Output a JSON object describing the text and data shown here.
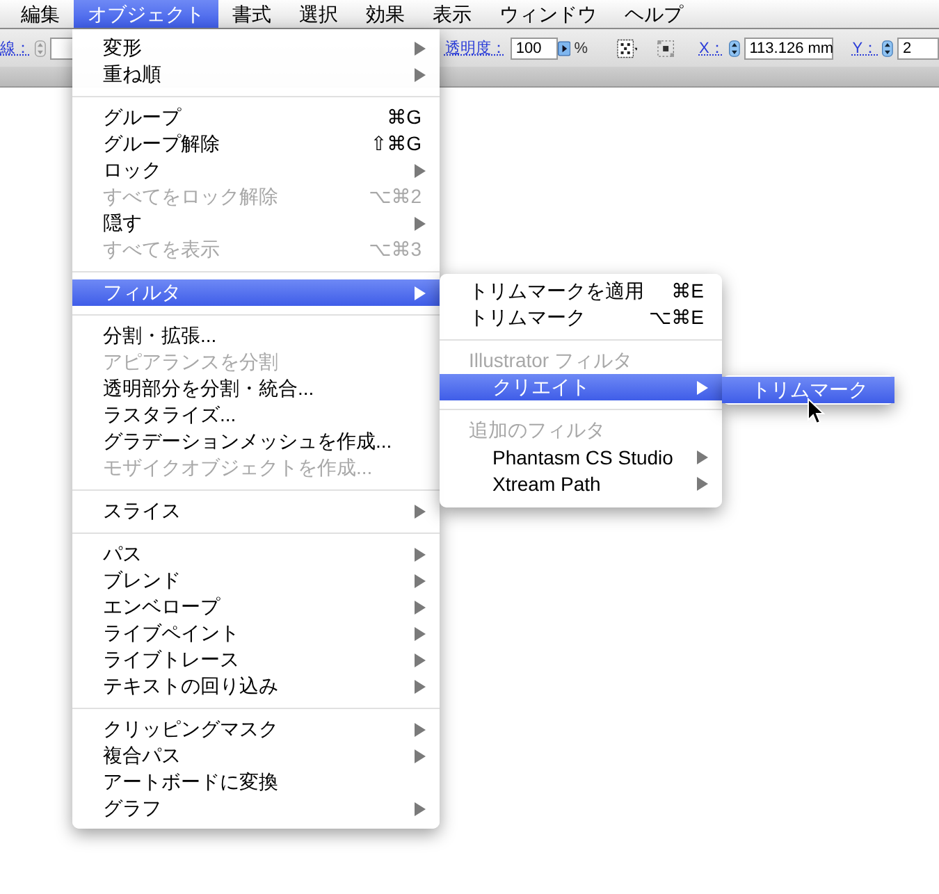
{
  "menubar": [
    {
      "label": "編集",
      "selected": false
    },
    {
      "label": "オブジェクト",
      "selected": true
    },
    {
      "label": "書式",
      "selected": false
    },
    {
      "label": "選択",
      "selected": false
    },
    {
      "label": "効果",
      "selected": false
    },
    {
      "label": "表示",
      "selected": false
    },
    {
      "label": "ウィンドウ",
      "selected": false
    },
    {
      "label": "ヘルプ",
      "selected": false
    }
  ],
  "toolbar": {
    "stroke_label": "線：",
    "opacity_label": "透明度：",
    "opacity_value": "100",
    "opacity_unit": "%",
    "x_label": "X：",
    "x_value": "113.126 mm",
    "y_label": "Y：",
    "y_value": "2"
  },
  "menu": {
    "items": [
      {
        "kind": "item",
        "label": "変形",
        "submenu": true,
        "disabled": false,
        "selected": false
      },
      {
        "kind": "item",
        "label": "重ね順",
        "submenu": true,
        "disabled": false,
        "selected": false
      },
      {
        "kind": "separator"
      },
      {
        "kind": "item",
        "label": "グループ",
        "shortcut": "⌘G",
        "submenu": false,
        "disabled": false,
        "selected": false
      },
      {
        "kind": "item",
        "label": "グループ解除",
        "shortcut": "⇧⌘G",
        "submenu": false,
        "disabled": false,
        "selected": false
      },
      {
        "kind": "item",
        "label": "ロック",
        "submenu": true,
        "disabled": false,
        "selected": false
      },
      {
        "kind": "item",
        "label": "すべてをロック解除",
        "shortcut": "⌥⌘2",
        "submenu": false,
        "disabled": true,
        "selected": false
      },
      {
        "kind": "item",
        "label": "隠す",
        "submenu": true,
        "disabled": false,
        "selected": false
      },
      {
        "kind": "item",
        "label": "すべてを表示",
        "shortcut": "⌥⌘3",
        "submenu": false,
        "disabled": true,
        "selected": false
      },
      {
        "kind": "separator"
      },
      {
        "kind": "item",
        "label": "フィルタ",
        "submenu": true,
        "disabled": false,
        "selected": true
      },
      {
        "kind": "separator"
      },
      {
        "kind": "item",
        "label": "分割・拡張...",
        "submenu": false,
        "disabled": false,
        "selected": false
      },
      {
        "kind": "item",
        "label": "アピアランスを分割",
        "submenu": false,
        "disabled": true,
        "selected": false
      },
      {
        "kind": "item",
        "label": "透明部分を分割・統合...",
        "submenu": false,
        "disabled": false,
        "selected": false
      },
      {
        "kind": "item",
        "label": "ラスタライズ...",
        "submenu": false,
        "disabled": false,
        "selected": false
      },
      {
        "kind": "item",
        "label": "グラデーションメッシュを作成...",
        "submenu": false,
        "disabled": false,
        "selected": false
      },
      {
        "kind": "item",
        "label": "モザイクオブジェクトを作成...",
        "submenu": false,
        "disabled": true,
        "selected": false
      },
      {
        "kind": "separator"
      },
      {
        "kind": "item",
        "label": "スライス",
        "submenu": true,
        "disabled": false,
        "selected": false
      },
      {
        "kind": "separator"
      },
      {
        "kind": "item",
        "label": "パス",
        "submenu": true,
        "disabled": false,
        "selected": false
      },
      {
        "kind": "item",
        "label": "ブレンド",
        "submenu": true,
        "disabled": false,
        "selected": false
      },
      {
        "kind": "item",
        "label": "エンベロープ",
        "submenu": true,
        "disabled": false,
        "selected": false
      },
      {
        "kind": "item",
        "label": "ライブペイント",
        "submenu": true,
        "disabled": false,
        "selected": false
      },
      {
        "kind": "item",
        "label": "ライブトレース",
        "submenu": true,
        "disabled": false,
        "selected": false
      },
      {
        "kind": "item",
        "label": "テキストの回り込み",
        "submenu": true,
        "disabled": false,
        "selected": false
      },
      {
        "kind": "separator"
      },
      {
        "kind": "item",
        "label": "クリッピングマスク",
        "submenu": true,
        "disabled": false,
        "selected": false
      },
      {
        "kind": "item",
        "label": "複合パス",
        "submenu": true,
        "disabled": false,
        "selected": false
      },
      {
        "kind": "item",
        "label": "アートボードに変換",
        "submenu": false,
        "disabled": false,
        "selected": false
      },
      {
        "kind": "item",
        "label": "グラフ",
        "submenu": true,
        "disabled": false,
        "selected": false
      }
    ]
  },
  "filter_submenu": {
    "items": [
      {
        "kind": "item",
        "label": "トリムマークを適用",
        "shortcut": "⌘E",
        "submenu": false,
        "disabled": false,
        "selected": false
      },
      {
        "kind": "item",
        "label": "トリムマーク",
        "shortcut": "⌥⌘E",
        "submenu": false,
        "disabled": false,
        "selected": false
      },
      {
        "kind": "separator"
      },
      {
        "kind": "header",
        "label": "Illustrator フィルタ",
        "children": [
          {
            "kind": "item",
            "label": "クリエイト",
            "submenu": true,
            "disabled": false,
            "selected": true
          }
        ]
      },
      {
        "kind": "separator"
      },
      {
        "kind": "header",
        "label": "追加のフィルタ",
        "children": [
          {
            "kind": "item",
            "label": "Phantasm CS Studio",
            "submenu": true,
            "disabled": false,
            "selected": false
          },
          {
            "kind": "item",
            "label": "Xtream Path",
            "submenu": true,
            "disabled": false,
            "selected": false
          }
        ]
      }
    ]
  },
  "create_submenu": {
    "items": [
      {
        "kind": "item",
        "label": "トリムマーク",
        "submenu": false,
        "disabled": false,
        "selected": true
      }
    ]
  }
}
